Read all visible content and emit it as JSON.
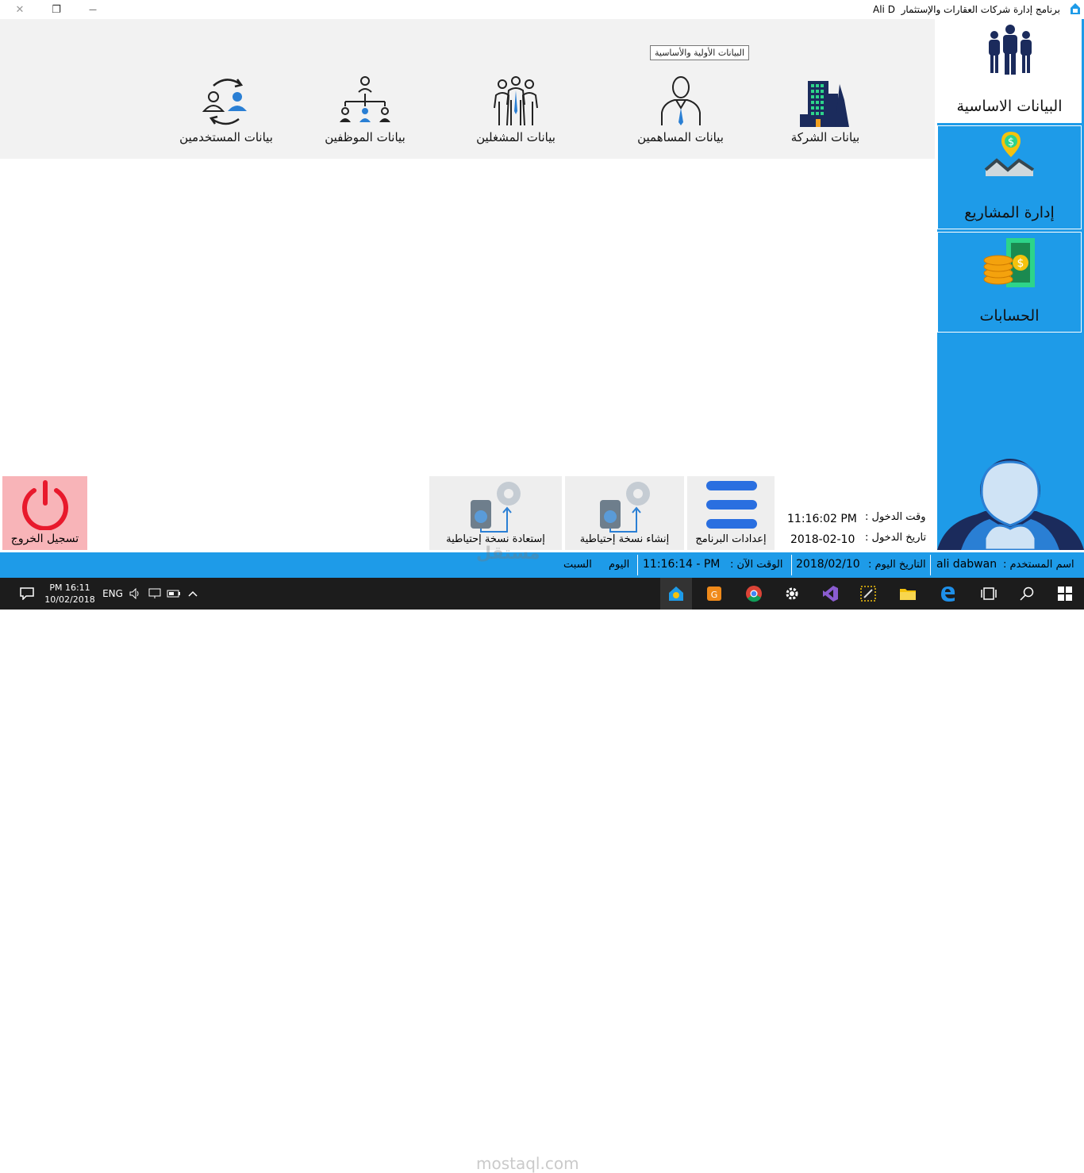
{
  "window": {
    "title": "برنامج إدارة شركات العقارات والإستثمار",
    "user_short": "Ali D",
    "controls": {
      "close": "✕",
      "restore": "❐",
      "minimize": "—"
    }
  },
  "sidebar": {
    "items": [
      {
        "label": "البيانات الاساسية",
        "icon": "people-group-icon"
      },
      {
        "label": "إدارة المشاريع",
        "icon": "house-dollar-icon"
      },
      {
        "label": "الحسابات",
        "icon": "coins-money-icon"
      }
    ]
  },
  "toolbar": {
    "tooltip": "البيانات الأولية والأساسية",
    "items": [
      {
        "label": "بيانات الشركة",
        "icon": "building-icon"
      },
      {
        "label": "بيانات المساهمين",
        "icon": "businessman-icon"
      },
      {
        "label": "بيانات المشغلين",
        "icon": "operators-group-icon"
      },
      {
        "label": "بيانات الموظفين",
        "icon": "org-chart-icon"
      },
      {
        "label": "بيانات المستخدمين",
        "icon": "users-sync-icon"
      }
    ]
  },
  "bottom_tiles": {
    "settings": "إعدادات البرنامج",
    "backup_create": "إنشاء نسخة إحتياطية",
    "backup_restore": "إستعادة نسخة إحتياطية",
    "logout": "تسجيل الخروج"
  },
  "login_info": {
    "time_label": "وقت الدخول :",
    "time_value": "11:16:02 PM",
    "date_label": "تاريخ الدخول :",
    "date_value": "2018-02-10"
  },
  "status_bar": {
    "user_label": "اسم المستخدم :",
    "user_value": "ali dabwan",
    "date_label": "التاريخ اليوم :",
    "date_value": "2018/02/10",
    "time_label": "الوقت الآن :",
    "time_value": "11:16:14 - PM",
    "day_label": "اليوم",
    "day_value": "السبت"
  },
  "taskbar": {
    "clock_time": "PM 16:11",
    "clock_date": "10/02/2018",
    "lang": "ENG"
  },
  "watermark": {
    "text": "مستقل",
    "url": "mostaql.com"
  },
  "colors": {
    "accent": "#1e9be8",
    "toolbar_bg": "#f2f2f2",
    "logout_bg": "#f8b4b8",
    "logout_icon": "#e8192c",
    "taskbar": "#1c1c1c"
  }
}
